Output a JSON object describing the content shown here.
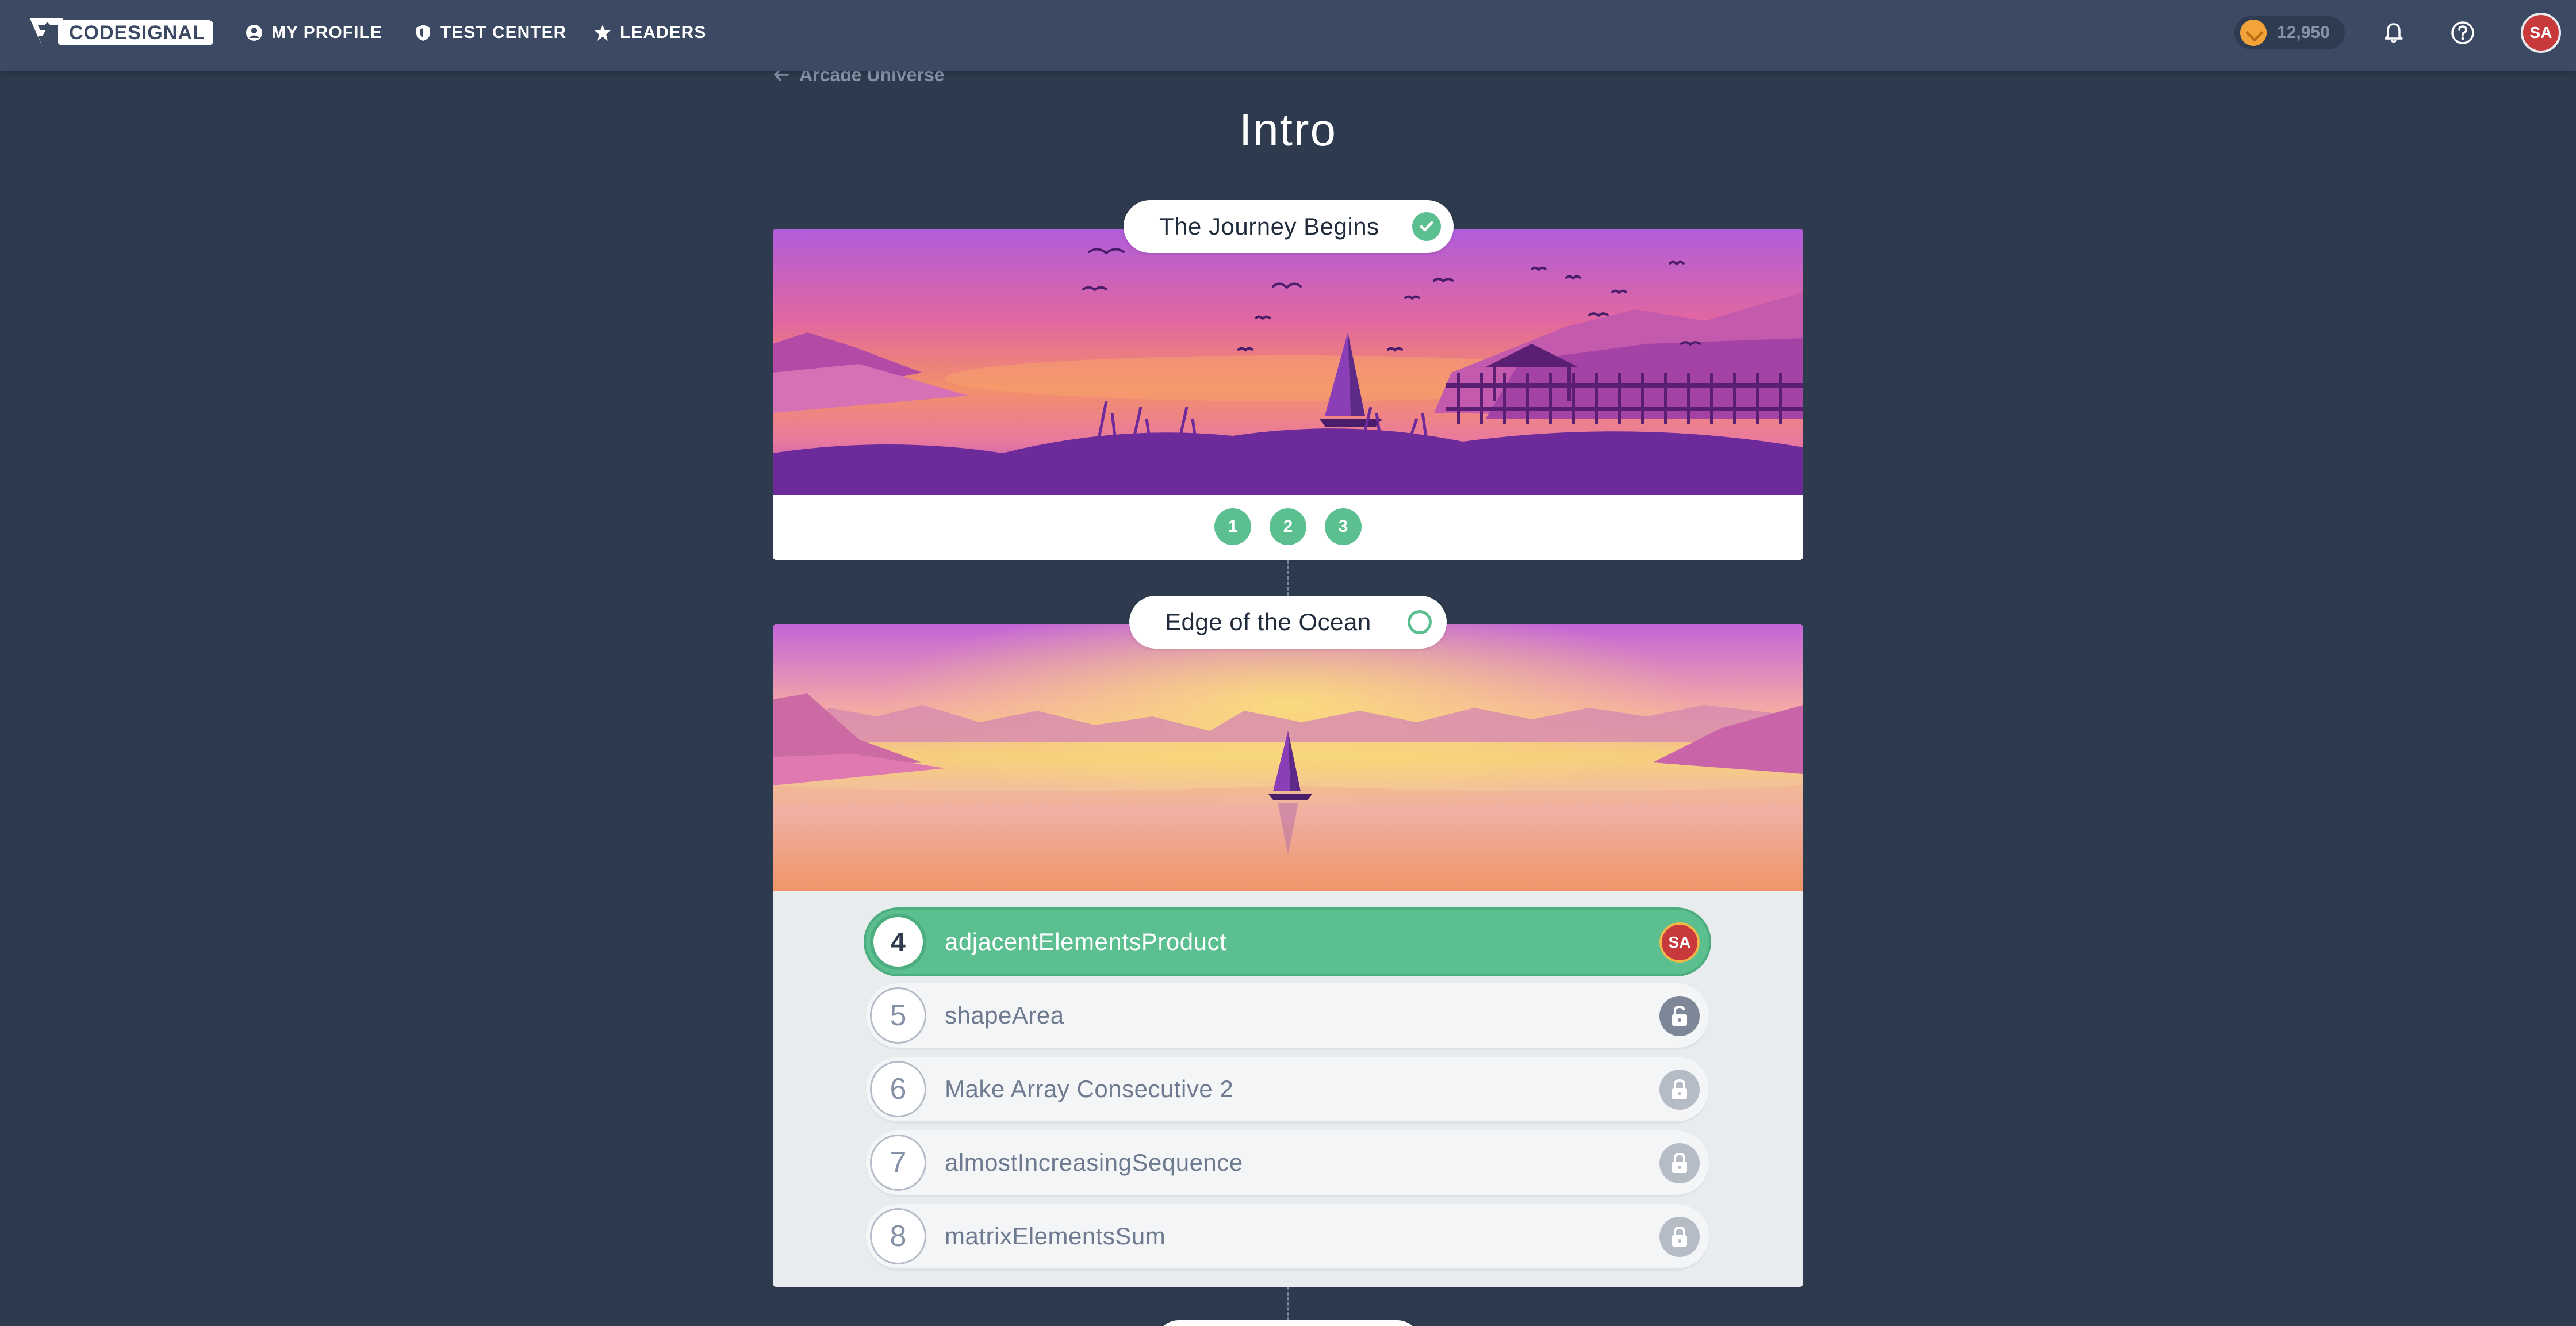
{
  "header": {
    "logo_text": "CODESIGNAL",
    "nav": [
      {
        "label": "MY PROFILE"
      },
      {
        "label": "TEST CENTER"
      },
      {
        "label": "LEADERS"
      }
    ],
    "coins": "12,950",
    "avatar_initials": "SA"
  },
  "breadcrumb": {
    "back_label": "Arcade Universe"
  },
  "page_title": "Intro",
  "areas": [
    {
      "title": "The Journey Begins",
      "completed": true,
      "steps": [
        "1",
        "2",
        "3"
      ]
    },
    {
      "title": "Edge of the Ocean",
      "completed": false,
      "tasks": [
        {
          "number": "4",
          "name": "adjacentElementsProduct",
          "state": "current",
          "badge": "SA"
        },
        {
          "number": "5",
          "name": "shapeArea",
          "state": "unlocked",
          "badge": "unlocked-icon"
        },
        {
          "number": "6",
          "name": "Make Array Consecutive 2",
          "state": "locked",
          "badge": "lock-icon"
        },
        {
          "number": "7",
          "name": "almostIncreasingSequence",
          "state": "locked",
          "badge": "lock-icon"
        },
        {
          "number": "8",
          "name": "matrixElementsSum",
          "state": "locked",
          "badge": "lock-icon"
        }
      ]
    }
  ],
  "colors": {
    "background": "#2e3a4d",
    "topbar": "#3b4962",
    "accent_green": "#5bbf8f",
    "avatar_red": "#c8393c",
    "coin_orange": "#f2a33a"
  }
}
